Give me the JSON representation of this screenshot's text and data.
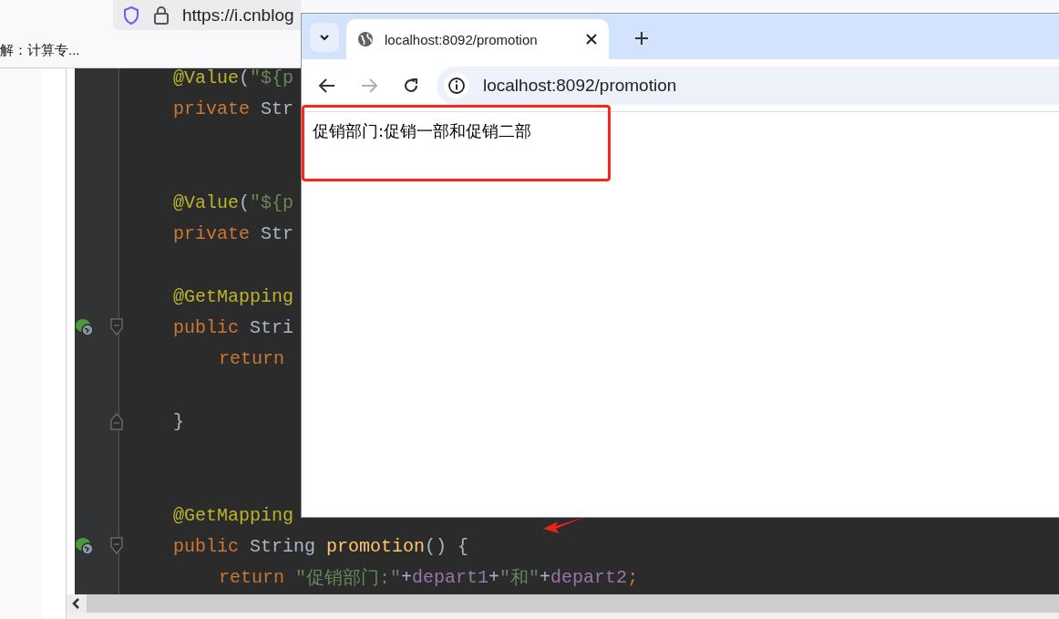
{
  "back_browser": {
    "url": "https://i.cnblog",
    "bookmark": "解：计算专..."
  },
  "editor": {
    "lines": [
      {
        "kind": "code",
        "run_icon": false,
        "fold_open": false,
        "fold_close": false,
        "tokens": [
          {
            "text": "@Value",
            "kind": "annotation"
          },
          {
            "text": "(",
            "kind": "plain"
          },
          {
            "text": "\"${p",
            "kind": "string"
          }
        ]
      },
      {
        "kind": "code",
        "run_icon": false,
        "fold_open": false,
        "fold_close": false,
        "tokens": [
          {
            "text": "private",
            "kind": "keyword"
          },
          {
            "text": "Str",
            "kind": "type"
          }
        ]
      },
      {
        "kind": "blank"
      },
      {
        "kind": "blank"
      },
      {
        "kind": "code",
        "run_icon": false,
        "fold_open": false,
        "fold_close": false,
        "tokens": [
          {
            "text": "@Value",
            "kind": "annotation"
          },
          {
            "text": "(",
            "kind": "plain"
          },
          {
            "text": "\"${p",
            "kind": "string"
          }
        ]
      },
      {
        "kind": "code",
        "run_icon": false,
        "fold_open": false,
        "fold_close": false,
        "tokens": [
          {
            "text": "private",
            "kind": "keyword"
          },
          {
            "text": "Str",
            "kind": "type"
          }
        ]
      },
      {
        "kind": "blank"
      },
      {
        "kind": "code",
        "run_icon": false,
        "fold_open": false,
        "fold_close": false,
        "tokens": [
          {
            "text": "@GetMapping",
            "kind": "annotation"
          }
        ]
      },
      {
        "kind": "code",
        "run_icon": true,
        "fold_open": true,
        "fold_close": false,
        "tokens": [
          {
            "text": "public",
            "kind": "keyword"
          },
          {
            "text": "Stri",
            "kind": "type"
          }
        ]
      },
      {
        "kind": "inner",
        "run_icon": false,
        "fold_open": false,
        "fold_close": false,
        "tokens": [
          {
            "text": "return",
            "kind": "keyword"
          }
        ]
      },
      {
        "kind": "blank"
      },
      {
        "kind": "code",
        "run_icon": false,
        "fold_open": false,
        "fold_close": true,
        "tokens": [
          {
            "text": "}",
            "kind": "plain"
          }
        ]
      },
      {
        "kind": "blank"
      },
      {
        "kind": "blank"
      },
      {
        "kind": "code",
        "run_icon": false,
        "fold_open": false,
        "fold_close": false,
        "tokens": [
          {
            "text": "@GetMapping",
            "kind": "annotation"
          }
        ]
      },
      {
        "kind": "code",
        "run_icon": true,
        "fold_open": true,
        "fold_close": false,
        "tokens": [
          {
            "text": "public",
            "kind": "keyword"
          },
          {
            "text": "String",
            "kind": "type"
          },
          {
            "text": "promotion",
            "kind": "method"
          },
          {
            "text": "() {",
            "kind": "plain"
          }
        ]
      },
      {
        "kind": "inner",
        "run_icon": false,
        "fold_open": false,
        "fold_close": false,
        "tokens": [
          {
            "text": "return",
            "kind": "keyword"
          },
          {
            "text": "\"促销部门:\"",
            "kind": "string"
          },
          {
            "text": "+",
            "kind": "plain"
          },
          {
            "text": "depart1",
            "kind": "field"
          },
          {
            "text": "+",
            "kind": "plain"
          },
          {
            "text": "\"和\"",
            "kind": "string"
          },
          {
            "text": "+",
            "kind": "plain"
          },
          {
            "text": "depart2",
            "kind": "field"
          },
          {
            "text": ";",
            "kind": "semicolon"
          }
        ]
      }
    ]
  },
  "popup_browser": {
    "tabs": [
      {
        "title": "localhost:8092/promotion",
        "selected": true
      }
    ],
    "url": "localhost:8092/promotion",
    "forward_disabled": true,
    "page_text": "促销部门:促销一部和促销二部",
    "highlighted": true
  }
}
